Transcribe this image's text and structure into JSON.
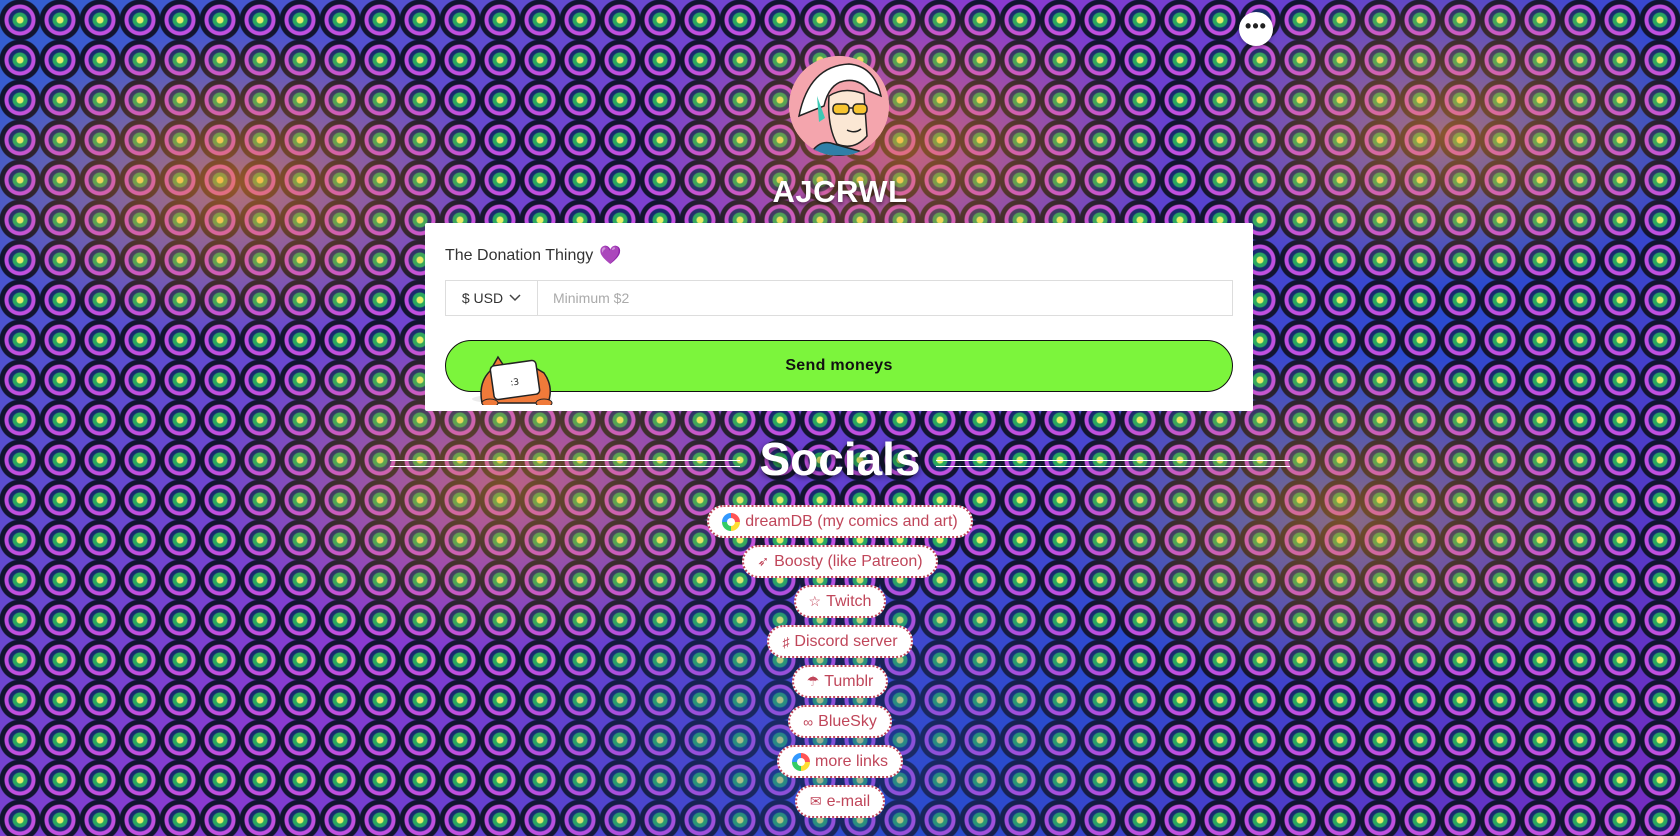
{
  "page": {
    "username": "AJCRWL",
    "menu_label": "•••"
  },
  "donation": {
    "title": "The Donation Thingy",
    "heart": "💜",
    "currency": "$ USD",
    "currency_chevron": "⌄",
    "amount_placeholder": "Minimum $2",
    "amount_value": "",
    "send_label": "Send moneys"
  },
  "socials": {
    "heading": "Socials",
    "links": [
      {
        "icon": "orb",
        "label": "dreamDB (my comics and art)"
      },
      {
        "icon": "➶",
        "label": "Boosty (like Patreon)"
      },
      {
        "icon": "☆",
        "label": "Twitch"
      },
      {
        "icon": "♯",
        "label": "Discord server"
      },
      {
        "icon": "☂",
        "label": "Tumblr"
      },
      {
        "icon": "∞",
        "label": "BlueSky"
      },
      {
        "icon": "orb",
        "label": "more links"
      },
      {
        "icon": "✉",
        "label": "e-mail"
      }
    ]
  },
  "colors": {
    "send_button": "#7cf53c",
    "link_text": "#c0465a",
    "heart": "#7b4fe0"
  }
}
